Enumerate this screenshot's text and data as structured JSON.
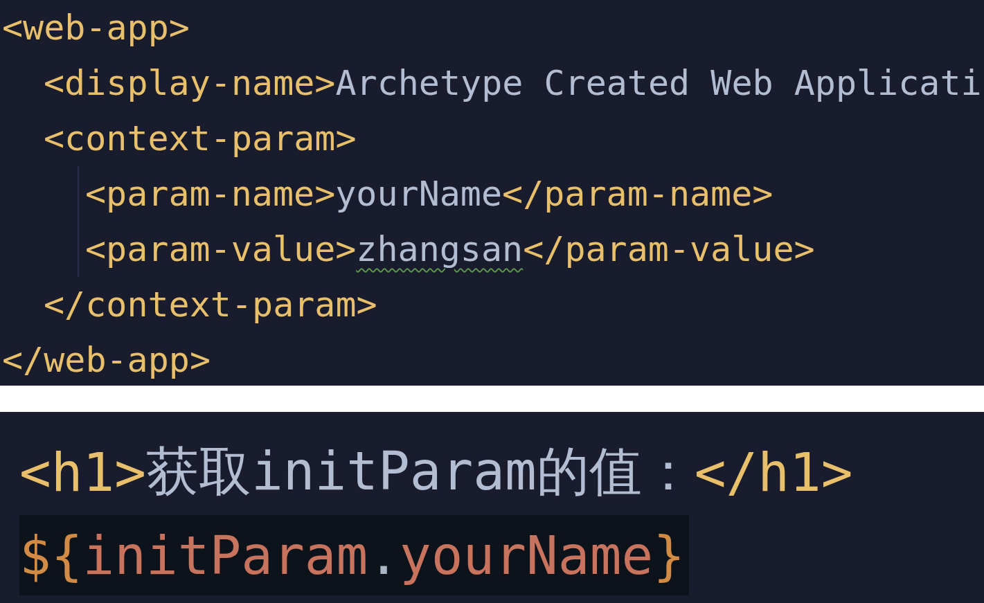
{
  "xml_editor": {
    "lines": [
      {
        "tokens": [
          {
            "kind": "tag",
            "text": "<web-app>"
          }
        ],
        "children": [
          {
            "tokens": [
              {
                "kind": "tag",
                "text": "<display-name>"
              },
              {
                "kind": "text",
                "text": "Archetype Created Web Applicati",
                "flagged": false
              }
            ]
          },
          {
            "tokens": [
              {
                "kind": "tag",
                "text": "<context-param>"
              }
            ],
            "children": [
              {
                "tokens": [
                  {
                    "kind": "tag",
                    "text": "<param-name>"
                  },
                  {
                    "kind": "text",
                    "text": "yourName",
                    "flagged": false
                  },
                  {
                    "kind": "tag",
                    "text": "</param-name>"
                  }
                ]
              },
              {
                "tokens": [
                  {
                    "kind": "tag",
                    "text": "<param-value>"
                  },
                  {
                    "kind": "text",
                    "text": "zhangsan",
                    "flagged": true
                  },
                  {
                    "kind": "tag",
                    "text": "</param-value>"
                  }
                ]
              }
            ]
          },
          {
            "tokens": [
              {
                "kind": "tag",
                "text": "</context-param>"
              }
            ]
          }
        ]
      },
      {
        "tokens": [
          {
            "kind": "tag",
            "text": "</web-app>"
          }
        ]
      }
    ]
  },
  "jsp_editor": {
    "lines": [
      {
        "highlighted": false,
        "tokens": [
          {
            "kind": "tag",
            "text": "<h1>"
          },
          {
            "kind": "text",
            "text": "获取initParam的值：",
            "flagged": false
          },
          {
            "kind": "tag",
            "text": "</h1>"
          }
        ]
      },
      {
        "highlighted": true,
        "tokens": [
          {
            "kind": "el_delim",
            "text": "${"
          },
          {
            "kind": "el_ident",
            "text": "initParam"
          },
          {
            "kind": "el_dot",
            "text": "."
          },
          {
            "kind": "el_ident",
            "text": "yourName"
          },
          {
            "kind": "el_delim",
            "text": "}"
          }
        ]
      }
    ]
  }
}
